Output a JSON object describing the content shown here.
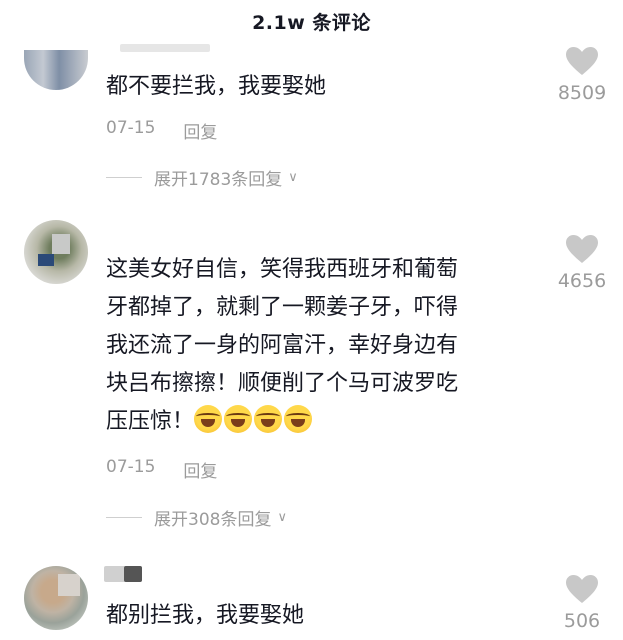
{
  "header": {
    "title": "2.1w 条评论"
  },
  "comments": [
    {
      "text": "都不要拦我，我要娶她",
      "date": "07-15",
      "reply_label": "回复",
      "expand_label": "展开1783条回复",
      "likes": "8509"
    },
    {
      "text_lines": [
        "这美女好自信，笑得我西班牙和葡萄",
        "牙都掉了，就剩了一颗姜子牙，吓得",
        "我还流了一身的阿富汗，幸好身边有",
        "块吕布擦擦！顺便削了个马可波罗吃",
        "压压惊！"
      ],
      "date": "07-15",
      "reply_label": "回复",
      "expand_label": "展开308条回复",
      "likes": "4656",
      "emoji_count": 4
    },
    {
      "text": "都别拦我，我要娶她",
      "likes": "506"
    }
  ],
  "colors": {
    "text": "#161823",
    "muted": "#9b9b9b",
    "heart": "#c8c8c8"
  }
}
